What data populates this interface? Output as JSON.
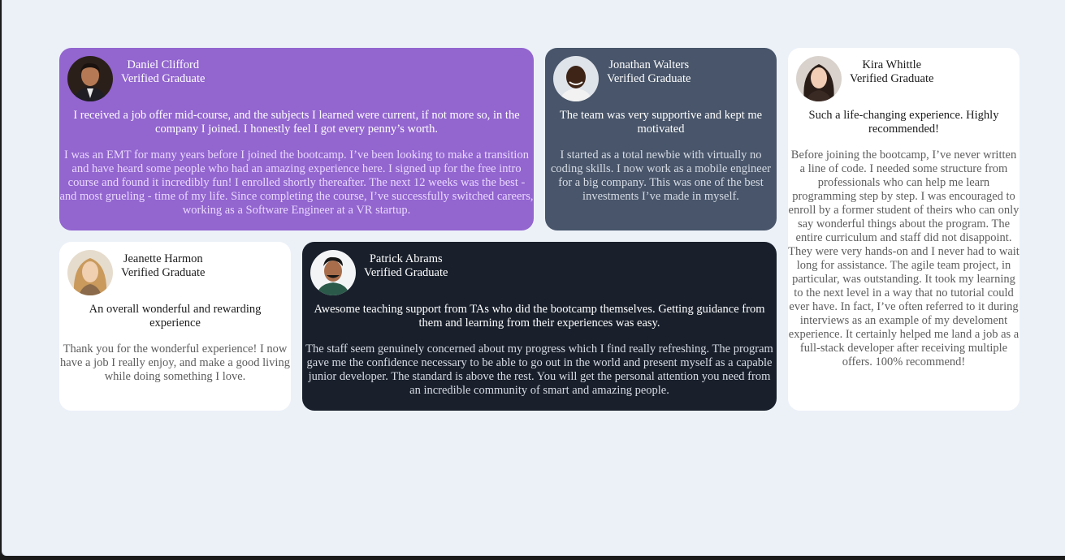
{
  "testimonials": [
    {
      "name": "Daniel Clifford",
      "role": "Verified Graduate",
      "quote": "I received a job offer mid-course, and the subjects I learned were current, if not more so, in the company I joined. I honestly feel I got every penny’s worth.",
      "body": "I was an EMT for many years before I joined the bootcamp. I’ve been looking to make a transition and have heard some people who had an amazing experience here. I signed up for the free intro course and found it incredibly fun! I enrolled shortly thereafter. The next 12 weeks was the best - and most grueling - time of my life. Since completing the course, I’ve successfully switched careers, working as a Software Engineer at a VR startup.",
      "card_color": "#9265cf"
    },
    {
      "name": "Jonathan Walters",
      "role": "Verified Graduate",
      "quote": "The team was very supportive and kept me motivated",
      "body": "I started as a total newbie with virtually no coding skills. I now work as a mobile engineer for a big company. This was one of the best investments I’ve made in myself.",
      "card_color": "#48556a"
    },
    {
      "name": "Kira Whittle",
      "role": "Verified Graduate",
      "quote": "Such a life-changing experience. Highly recommended!",
      "body": "Before joining the bootcamp, I’ve never written a line of code. I needed some structure from professionals who can help me learn programming step by step. I was encouraged to enroll by a former student of theirs who can only say wonderful things about the program. The entire curriculum and staff did not disappoint. They were very hands-on and I never had to wait long for assistance. The agile team project, in particular, was outstanding. It took my learning to the next level in a way that no tutorial could ever have. In fact, I’ve often referred to it during interviews as an example of my develoment experience. It certainly helped me land a job as a full-stack developer after receiving multiple offers. 100% recommend!",
      "card_color": "#ffffff"
    },
    {
      "name": "Jeanette Harmon",
      "role": "Verified Graduate",
      "quote": "An overall wonderful and rewarding experience",
      "body": "Thank you for the wonderful experience! I now have a job I really enjoy, and make a good living while doing something I love.",
      "card_color": "#ffffff"
    },
    {
      "name": "Patrick Abrams",
      "role": "Verified Graduate",
      "quote": "Awesome teaching support from TAs who did the bootcamp themselves. Getting guidance from them and learning from their experiences was easy.",
      "body": "The staff seem genuinely concerned about my progress which I find really refreshing. The program gave me the confidence necessary to be able to go out in the world and present myself as a capable junior developer. The standard is above the rest. You will get the personal attention you need from an incredible community of smart and amazing people.",
      "card_color": "#19202c"
    }
  ],
  "theme": {
    "page_background": "#ecf1f8"
  }
}
